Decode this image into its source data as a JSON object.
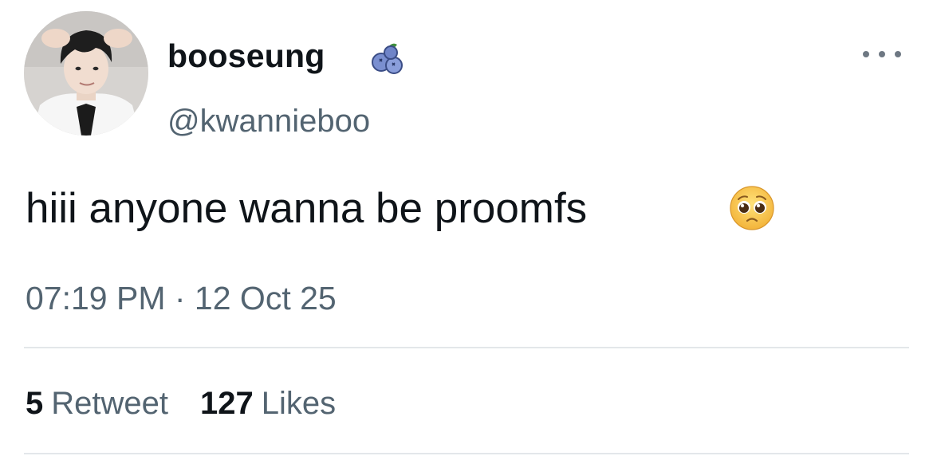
{
  "author": {
    "display_name": "booseung",
    "handle": "@kwannieboo",
    "badge_icon": "blueberries-icon",
    "avatar_icon": "avatar-photo"
  },
  "tweet": {
    "text": "hiii anyone wanna be proomfs",
    "emoji_icon": "pleading-face-emoji-icon",
    "timestamp": "07:19 PM · 12 Oct 25"
  },
  "stats": {
    "retweets_count": "5",
    "retweets_label": "Retweet",
    "likes_count": "127",
    "likes_label": "Likes"
  },
  "more_icon": "more-options-icon",
  "colors": {
    "primary_text": "#0f1419",
    "secondary_text": "#536471",
    "divider": "#e3e7ea",
    "badge_blue": "#5b72b8"
  }
}
